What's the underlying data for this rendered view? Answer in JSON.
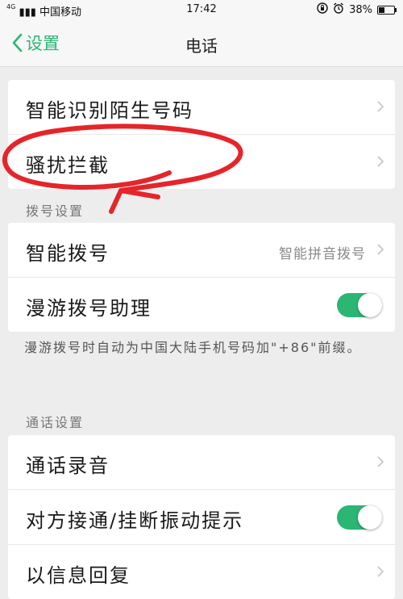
{
  "status_bar": {
    "carrier": "中国移动",
    "network_badge": "4G",
    "time": "17:42",
    "battery": "38%",
    "icons": [
      "signal-icon",
      "lock-rotation-icon",
      "alarm-icon",
      "battery-icon"
    ]
  },
  "nav": {
    "back_label": "设置",
    "title": "电话"
  },
  "group1": {
    "smart_identify": "智能识别陌生号码",
    "harass_block": "骚扰拦截"
  },
  "section_dial": "拨号设置",
  "group2": {
    "smart_dial": "智能拨号",
    "smart_dial_value": "智能拼音拨号",
    "roaming_assistant": "漫游拨号助理",
    "roaming_assistant_on": true
  },
  "roaming_note": "漫游拨号时自动为中国大陆手机号码加\"+86\"前缀。",
  "section_call": "通话设置",
  "group3": {
    "call_recording": "通话录音",
    "vibrate_hint": "对方接通/挂断振动提示",
    "vibrate_hint_on": true,
    "sms_reply": "以信息回复"
  },
  "colors": {
    "accent": "#2bb673",
    "annotation": "#e5252a"
  }
}
